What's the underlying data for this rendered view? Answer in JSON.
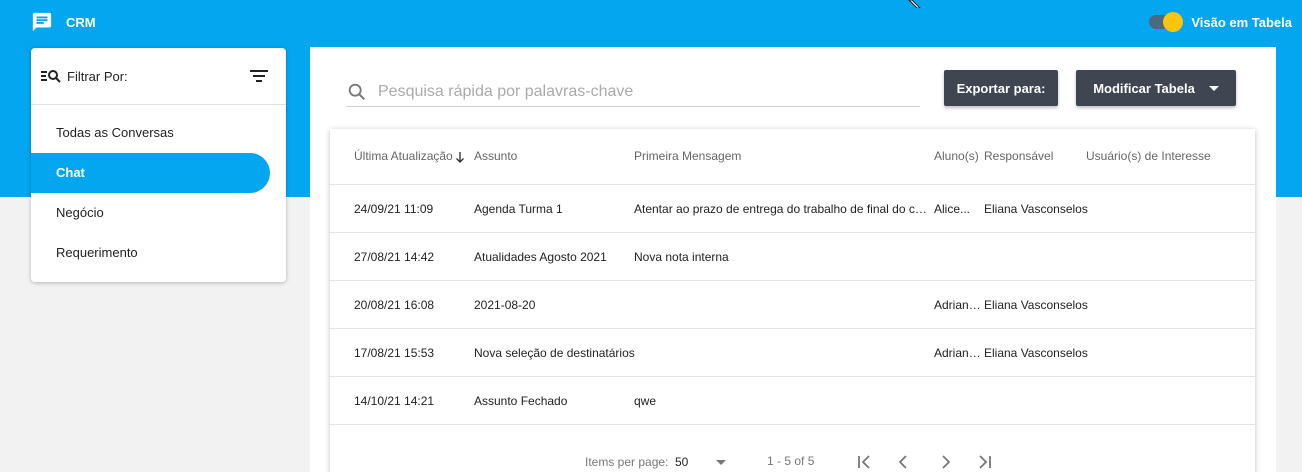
{
  "app": {
    "title": "CRM",
    "toggle_label": "Visão em Tabela",
    "toggle_on": true
  },
  "filter": {
    "label": "Filtrar Por:",
    "items": [
      {
        "label": "Todas as Conversas",
        "active": false
      },
      {
        "label": "Chat",
        "active": true
      },
      {
        "label": "Negócio",
        "active": false
      },
      {
        "label": "Requerimento",
        "active": false
      }
    ]
  },
  "search": {
    "placeholder": "Pesquisa rápida por palavras-chave",
    "value": ""
  },
  "toolbar": {
    "export_label": "Exportar para:",
    "modify_label": "Modificar Tabela"
  },
  "table": {
    "columns": [
      "Última Atualização",
      "Assunto",
      "Primeira Mensagem",
      "Aluno(s)",
      "Responsável",
      "Usuário(s) de Interesse"
    ],
    "rows": [
      {
        "updated": "24/09/21 11:09",
        "subject": "Agenda Turma 1",
        "first_message": "Atentar ao prazo de entrega do trabalho de final do curso",
        "students": "Alice...",
        "responsible": "Eliana Vasconselos",
        "interested": ""
      },
      {
        "updated": "27/08/21 14:42",
        "subject": "Atualidades Agosto 2021",
        "first_message": "Nova nota interna",
        "students": "",
        "responsible": "",
        "interested": ""
      },
      {
        "updated": "20/08/21 16:08",
        "subject": "2021-08-20",
        "first_message": "",
        "students": "Adriana...",
        "responsible": "Eliana Vasconselos",
        "interested": ""
      },
      {
        "updated": "17/08/21 15:53",
        "subject": "Nova seleção de destinatários",
        "first_message": "",
        "students": "Adriana...",
        "responsible": "Eliana Vasconselos",
        "interested": ""
      },
      {
        "updated": "14/10/21 14:21",
        "subject": "Assunto Fechado",
        "first_message": "qwe",
        "students": "",
        "responsible": "",
        "interested": ""
      }
    ]
  },
  "paginator": {
    "items_per_page_label": "Items per page:",
    "page_size": "50",
    "range_label": "1 - 5 of 5"
  },
  "colors": {
    "primary": "#03a6ef",
    "dark_button": "#3f4651",
    "toggle_knob": "#fbc40d"
  }
}
